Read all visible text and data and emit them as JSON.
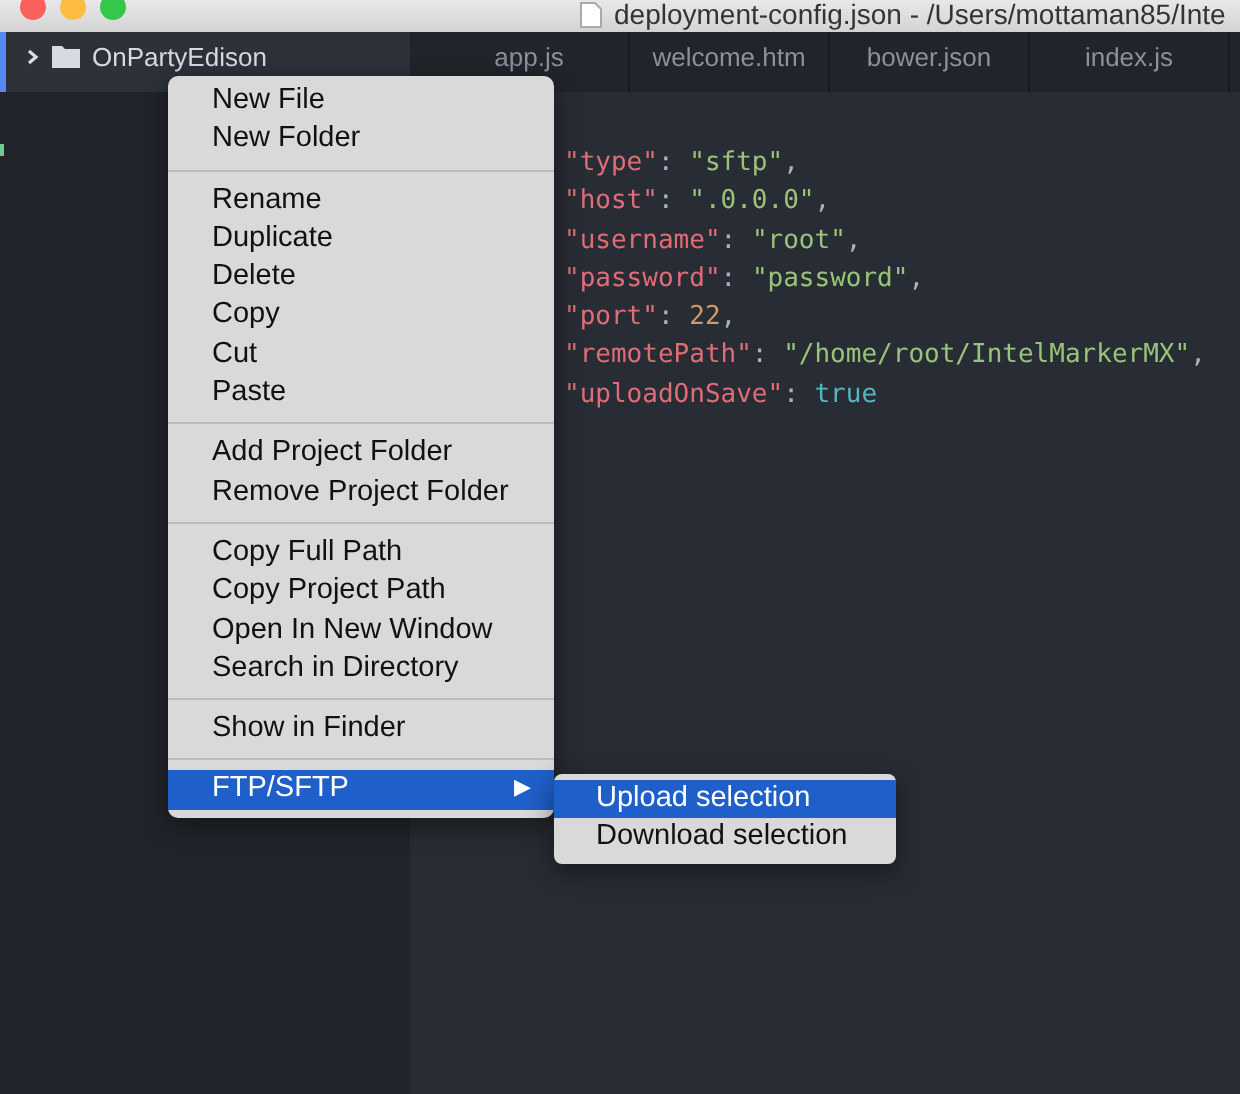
{
  "window": {
    "title": "deployment-config.json - /Users/mottaman85/Inte"
  },
  "tree": {
    "items": [
      {
        "label": "OnPartyEdison",
        "expanded": false,
        "selected": true
      }
    ]
  },
  "tabs": [
    {
      "label": "app.js",
      "selected": false
    },
    {
      "label": "welcome.htm",
      "selected": false
    },
    {
      "label": "bower.json",
      "selected": false
    },
    {
      "label": "index.js",
      "selected": false
    }
  ],
  "code": {
    "lines": [
      [
        {
          "text": "\"type\"",
          "kind": "key"
        },
        {
          "text": ": ",
          "kind": "punct"
        },
        {
          "text": "\"sftp\"",
          "kind": "string"
        },
        {
          "text": ",",
          "kind": "punct"
        }
      ],
      [
        {
          "text": "\"host\"",
          "kind": "key"
        },
        {
          "text": ": ",
          "kind": "punct"
        },
        {
          "text": "\".0.0.0\"",
          "kind": "string"
        },
        {
          "text": ",",
          "kind": "punct"
        }
      ],
      [
        {
          "text": "\"username\"",
          "kind": "key"
        },
        {
          "text": ": ",
          "kind": "punct"
        },
        {
          "text": "\"root\"",
          "kind": "string"
        },
        {
          "text": ",",
          "kind": "punct"
        }
      ],
      [
        {
          "text": "\"password\"",
          "kind": "key"
        },
        {
          "text": ": ",
          "kind": "punct"
        },
        {
          "text": "\"password\"",
          "kind": "string"
        },
        {
          "text": ",",
          "kind": "punct"
        }
      ],
      [
        {
          "text": "\"port\"",
          "kind": "key"
        },
        {
          "text": ": ",
          "kind": "punct"
        },
        {
          "text": "22",
          "kind": "number"
        },
        {
          "text": ",",
          "kind": "punct"
        }
      ],
      [
        {
          "text": "\"remotePath\"",
          "kind": "key"
        },
        {
          "text": ": ",
          "kind": "punct"
        },
        {
          "text": "\"/home/root/IntelMarkerMX\"",
          "kind": "string"
        },
        {
          "text": ",",
          "kind": "punct"
        }
      ],
      [
        {
          "text": "\"uploadOnSave\"",
          "kind": "key"
        },
        {
          "text": ": ",
          "kind": "punct"
        },
        {
          "text": "true",
          "kind": "boolean"
        }
      ]
    ]
  },
  "context_menu": {
    "groups": [
      [
        {
          "label": "New File",
          "selected": false
        },
        {
          "label": "New Folder",
          "selected": false
        }
      ],
      [
        {
          "label": "Rename",
          "selected": false
        },
        {
          "label": "Duplicate",
          "selected": false
        },
        {
          "label": "Delete",
          "selected": false
        },
        {
          "label": "Copy",
          "selected": false
        },
        {
          "label": "Cut",
          "selected": false
        },
        {
          "label": "Paste",
          "selected": false
        }
      ],
      [
        {
          "label": "Add Project Folder",
          "selected": false
        },
        {
          "label": "Remove Project Folder",
          "selected": false
        }
      ],
      [
        {
          "label": "Copy Full Path",
          "selected": false
        },
        {
          "label": "Copy Project Path",
          "selected": false
        },
        {
          "label": "Open In New Window",
          "selected": false
        },
        {
          "label": "Search in Directory",
          "selected": false
        }
      ],
      [
        {
          "label": "Show in Finder",
          "selected": false
        }
      ],
      [
        {
          "label": "FTP/SFTP",
          "selected": true,
          "submenu_arrow": "▶"
        }
      ]
    ]
  },
  "submenu": {
    "items": [
      {
        "label": "Upload selection",
        "selected": true
      },
      {
        "label": "Download selection",
        "selected": false
      }
    ]
  }
}
